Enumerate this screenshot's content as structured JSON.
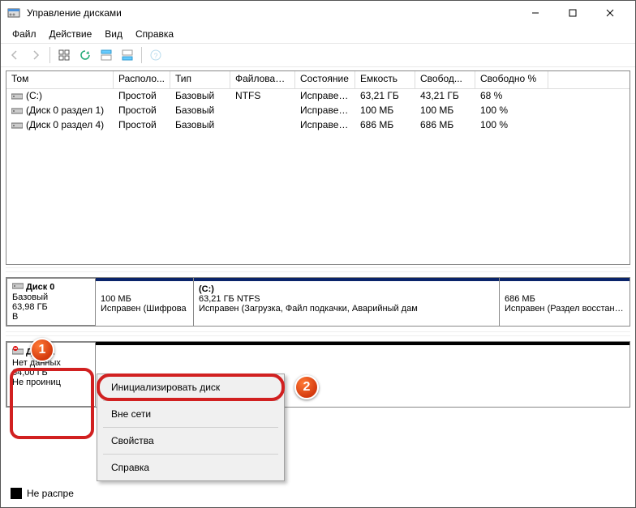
{
  "window": {
    "title": "Управление дисками"
  },
  "menu": {
    "file": "Файл",
    "action": "Действие",
    "view": "Вид",
    "help": "Справка"
  },
  "columns": [
    "Том",
    "Располо...",
    "Тип",
    "Файловая с...",
    "Состояние",
    "Емкость",
    "Свобод...",
    "Свободно %"
  ],
  "rows": [
    {
      "vol": "(C:)",
      "layout": "Простой",
      "type": "Базовый",
      "fs": "NTFS",
      "status": "Исправен...",
      "cap": "63,21 ГБ",
      "free": "43,21 ГБ",
      "pct": "68 %"
    },
    {
      "vol": "(Диск 0 раздел 1)",
      "layout": "Простой",
      "type": "Базовый",
      "fs": "",
      "status": "Исправен...",
      "cap": "100 МБ",
      "free": "100 МБ",
      "pct": "100 %"
    },
    {
      "vol": "(Диск 0 раздел 4)",
      "layout": "Простой",
      "type": "Базовый",
      "fs": "",
      "status": "Исправен...",
      "cap": "686 МБ",
      "free": "686 МБ",
      "pct": "100 %"
    }
  ],
  "disk0": {
    "name": "Диск 0",
    "type": "Базовый",
    "size": "63,98 ГБ",
    "status": "В",
    "parts": {
      "p1": {
        "size": "100 МБ",
        "status": "Исправен (Шифрова"
      },
      "p2": {
        "label": "(C:)",
        "size": "63,21 ГБ NTFS",
        "status": "Исправен (Загрузка, Файл подкачки, Аварийный дам"
      },
      "p3": {
        "size": "686 МБ",
        "status": "Исправен (Раздел восстановле"
      }
    }
  },
  "disk1": {
    "name": "Диск 1",
    "type": "Нет данных",
    "size": "64,00 ГБ",
    "status": "Не проиниц"
  },
  "context": {
    "init": "Инициализировать диск",
    "offline": "Вне сети",
    "props": "Свойства",
    "help": "Справка"
  },
  "legend": {
    "unalloc": "Не распре"
  },
  "badges": {
    "one": "1",
    "two": "2"
  }
}
